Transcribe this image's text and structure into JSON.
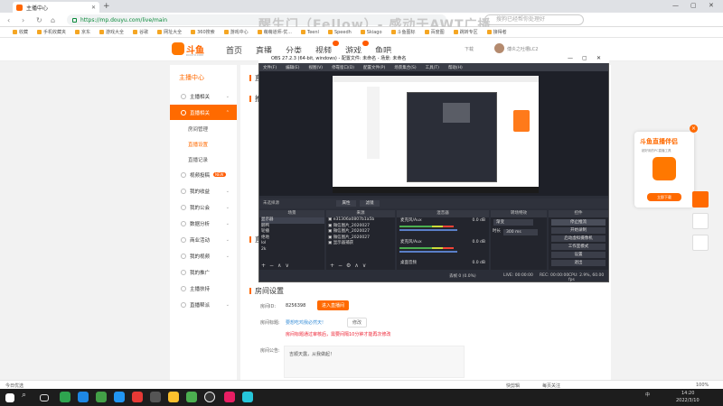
{
  "browser": {
    "tab_title": "主播中心",
    "url": "https://mp.douyu.com/live/main",
    "overlay_title": "醒生门（Fellow）- 感动于AWT广播",
    "search_placeholder": "搜狗已经帮你处理好",
    "bookmarks": [
      "收藏",
      "手机收藏夹",
      "京东",
      "游戏大全",
      "谷歌",
      "网址大全",
      "360搜索",
      "游戏中心",
      "萌萌道师·优...",
      "Teenl",
      "Speedh",
      "Skiago",
      "斗鱼图标",
      "百度图",
      "跳转专区",
      "接得者"
    ],
    "win_minimize": "—",
    "win_maximize": "▢",
    "win_close": "✕"
  },
  "site_header": {
    "logo_text": "斗鱼",
    "logo_sub": "DOUYU.COM",
    "nav": [
      "首页",
      "直播",
      "分类",
      "视频",
      "游戏",
      "鱼吧"
    ],
    "download": "下载",
    "username": "傅炎之吐槽LC2"
  },
  "sidebar": {
    "title": "主播中心",
    "items": [
      {
        "label": "主播相关",
        "arrow": "⌄"
      },
      {
        "label": "直播相关",
        "arrow": "⌃"
      },
      {
        "label": "房间管理"
      },
      {
        "label": "直播设置"
      },
      {
        "label": "直播记录"
      },
      {
        "label": "视频投稿",
        "badge": "NEW"
      },
      {
        "label": "我的收益",
        "arrow": "⌄"
      },
      {
        "label": "我的公会",
        "arrow": "⌄"
      },
      {
        "label": "数据分析",
        "arrow": "⌄"
      },
      {
        "label": "商业活动",
        "arrow": "⌄"
      },
      {
        "label": "我的视频",
        "arrow": "⌄"
      },
      {
        "label": "我的推广"
      },
      {
        "label": "主播扶持"
      },
      {
        "label": "直播帮派",
        "arrow": "⌄"
      }
    ]
  },
  "main": {
    "partial_head_1": "直",
    "partial_head_2": "推",
    "partial_head_3": "直",
    "room_settings": {
      "heading": "房间设置",
      "room_id_label": "房间ID:",
      "room_id": "8256398",
      "enter_button": "进入直播间",
      "title_label": "房间标题:",
      "title_value": "要想吃鸡我必然天!",
      "edit_button": "修改",
      "warning": "房间标题通过审核后，需要间隔10分钟才能再次修改",
      "notice_label": "房间公告:",
      "notice_value": "吉顺天露，从我做起！"
    }
  },
  "obs": {
    "title": "OBS 27.2.3 (64-bit, windows) - 配置文件: 未命名 - 场景: 未命名",
    "menu": [
      "文件(F)",
      "编辑(E)",
      "视图(V)",
      "停靠窗口(D)",
      "配置文件(P)",
      "场景集合(S)",
      "工具(T)",
      "帮助(H)"
    ],
    "no_source": "未选择源",
    "properties": "属性",
    "filters": "滤镜",
    "panels": [
      "场景",
      "来源",
      "混音器",
      "转场特效",
      "控件"
    ],
    "scenes": [
      "显示器",
      "鹅鸭",
      "轮播",
      "绝地",
      "lol",
      "2k"
    ],
    "sources": [
      "e31306a0807b1a5b",
      "微信图片_2020027",
      "微信图片_2020027",
      "微信图片_2020027",
      "显示器捕获"
    ],
    "mixer": [
      {
        "name": "麦克风/Aux",
        "db": "0.0 dB"
      },
      {
        "name": "麦克风/Aux",
        "db": "0.0 dB"
      },
      {
        "name": "桌面音频",
        "db": "0.0 dB"
      }
    ],
    "transition": {
      "type": "渐变",
      "duration_label": "时长",
      "duration": "300 ms"
    },
    "controls": [
      "停止推流",
      "开始录制",
      "启动虚拟摄像机",
      "工作室模式",
      "设置",
      "退出"
    ],
    "status": {
      "live": "LIVE: 00:00:00",
      "rec": "REC: 00:00:00",
      "cpu": "CPU: 2.9%, 60.00 fps",
      "dropped": "丢帧 0 (0.0%)"
    }
  },
  "widget": {
    "title": "斗鱼直播伴侣",
    "subtitle": "超好用的PC直播工具",
    "button": "立即下载",
    "close": "×"
  },
  "statusbar": {
    "left": "今日优选",
    "right_items": [
      "快剪辑",
      "每页关注",
      "100%"
    ]
  },
  "taskbar": {
    "time": "14:20",
    "date": "2022/3/10",
    "lang": "中"
  }
}
